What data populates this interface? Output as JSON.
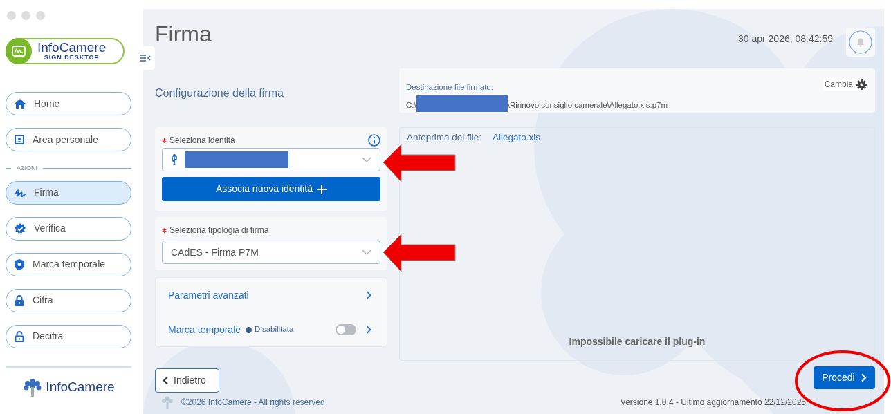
{
  "sidebar": {
    "logo": {
      "name": "InfoCamere",
      "subtitle": "SIGN DESKTOP"
    },
    "items": [
      {
        "label": "Home",
        "kind": "home",
        "selected": false
      },
      {
        "label": "Area personale",
        "kind": "contact",
        "selected": false
      }
    ],
    "section": {
      "label": "AZIONI",
      "items": [
        {
          "label": "Firma",
          "kind": "signature",
          "selected": true
        },
        {
          "label": "Verifica",
          "kind": "badge",
          "selected": false
        },
        {
          "label": "Marca temporale",
          "kind": "shield",
          "selected": false
        },
        {
          "label": "Cifra",
          "kind": "lock",
          "selected": false
        },
        {
          "label": "Decifra",
          "kind": "unlock",
          "selected": false
        }
      ]
    },
    "footer_logo": "InfoCamere"
  },
  "header": {
    "title": "Firma",
    "datetime": "30 apr 2026, 08:42:59"
  },
  "config_title": "Configurazione della firma",
  "identity": {
    "label": "Seleziona identità",
    "required": true,
    "redacted": true,
    "add_button": "Associa nuova identità"
  },
  "signature_type": {
    "label": "Seleziona tipologia di firma",
    "required": true,
    "value": "CAdES - Firma P7M"
  },
  "advanced": {
    "label": "Parametri avanzati"
  },
  "timestamp": {
    "label": "Marca temporale",
    "status": "Disabilitata",
    "on": false
  },
  "destination": {
    "label": "Destinazione file firmato:",
    "path_prefix": "C:\\",
    "redacted": true,
    "path_suffix": "\\Rinnovo consiglio camerale\\Allegato.xls.p7m",
    "action": "Cambia"
  },
  "preview": {
    "label": "Anteprima del file:",
    "file": "Allegato.xls",
    "message": "Impossibile caricare il plug-in"
  },
  "buttons": {
    "back": "Indietro",
    "next": "Procedi"
  },
  "footer": {
    "copyright": "©2026 InfoCamere - All rights reserved",
    "version": "Versione 1.0.4 - Ultimo aggiornamento 22/12/2025"
  },
  "annotations": [
    {
      "kind": "arrow"
    },
    {
      "kind": "arrow"
    },
    {
      "kind": "ellipse"
    }
  ]
}
